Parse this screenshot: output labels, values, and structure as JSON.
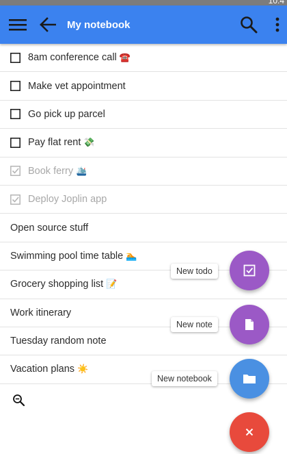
{
  "status_bar": {
    "time": "10:4"
  },
  "app_bar": {
    "title": "My notebook",
    "menu_icon": "hamburger-icon",
    "back_icon": "arrow-left-icon",
    "search_icon": "search-icon",
    "more_icon": "more-vertical-icon",
    "color": "#3b82ef"
  },
  "notes": [
    {
      "type": "todo",
      "checked": false,
      "title": "8am conference call",
      "emoji": "☎️"
    },
    {
      "type": "todo",
      "checked": false,
      "title": "Make vet appointment",
      "emoji": ""
    },
    {
      "type": "todo",
      "checked": false,
      "title": "Go pick up parcel",
      "emoji": ""
    },
    {
      "type": "todo",
      "checked": false,
      "title": "Pay flat rent",
      "emoji": "💸"
    },
    {
      "type": "todo",
      "checked": true,
      "title": "Book ferry",
      "emoji": "🛳️"
    },
    {
      "type": "todo",
      "checked": true,
      "title": "Deploy Joplin app",
      "emoji": ""
    },
    {
      "type": "note",
      "title": "Open source stuff",
      "emoji": ""
    },
    {
      "type": "note",
      "title": "Swimming pool time table",
      "emoji": "🏊"
    },
    {
      "type": "note",
      "title": "Grocery shopping list",
      "emoji": "📝"
    },
    {
      "type": "note",
      "title": "Work itinerary",
      "emoji": ""
    },
    {
      "type": "note",
      "title": "Tuesday random note",
      "emoji": ""
    },
    {
      "type": "note",
      "title": "Vacation plans",
      "emoji": "☀️"
    }
  ],
  "fab_menu": {
    "new_todo_label": "New todo",
    "new_note_label": "New note",
    "new_notebook_label": "New notebook",
    "todo_color": "#9b59c6",
    "note_color": "#9b59c6",
    "notebook_color": "#4a90e2",
    "close_color": "#e84a3c"
  }
}
